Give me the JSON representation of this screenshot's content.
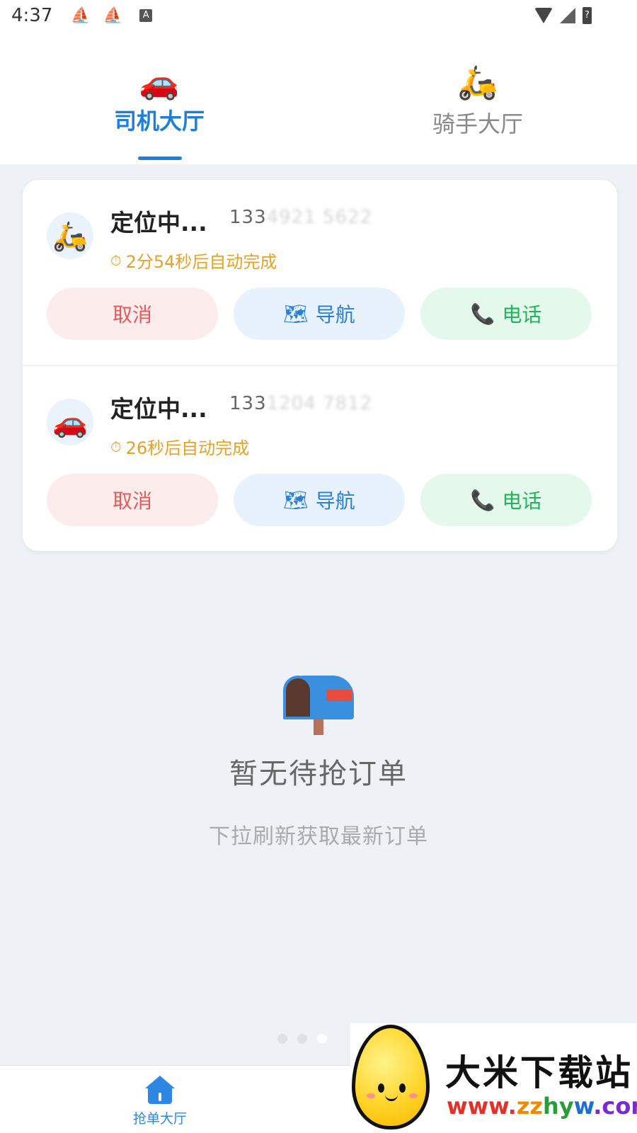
{
  "status_bar": {
    "time": "4:37",
    "icons": [
      "ship-icon",
      "ship-icon",
      "a-notification-icon",
      "wifi-icon",
      "signal-icon",
      "battery-icon"
    ],
    "battery_glyph": "?"
  },
  "top_tabs": [
    {
      "label": "司机大厅",
      "icon": "🚗",
      "active": true
    },
    {
      "label": "骑手大厅",
      "icon": "🛵",
      "active": false
    }
  ],
  "orders": [
    {
      "avatar_icon": "🛵",
      "title": "定位中...",
      "phone_prefix": "133",
      "phone_masked": "4921 5622",
      "timer": "2分54秒后自动完成",
      "buttons": {
        "cancel": "取消",
        "navigate": "导航",
        "call": "电话"
      }
    },
    {
      "avatar_icon": "🚗",
      "title": "定位中...",
      "phone_prefix": "133",
      "phone_masked": "1204 7812",
      "timer": "26秒后自动完成",
      "buttons": {
        "cancel": "取消",
        "navigate": "导航",
        "call": "电话"
      }
    }
  ],
  "icons": {
    "timer": "⏱",
    "navigate": "🗺",
    "call": "📞"
  },
  "empty_state": {
    "title": "暂无待抢订单",
    "subtitle": "下拉刷新获取最新订单"
  },
  "page_dots": {
    "count": 3,
    "active_index": 2
  },
  "bottom_nav": {
    "items": [
      {
        "label": "抢单大厅",
        "icon": "home-icon",
        "active": true
      }
    ]
  },
  "watermark": {
    "title": "大米下载站",
    "url_parts": [
      "www.",
      "zz",
      "hy",
      "w",
      ".com"
    ]
  },
  "colors": {
    "accent": "#1f7fd8",
    "timer": "#e8a223",
    "cancel": "#e25a5a",
    "navigate": "#2a7fd4",
    "call": "#22b35e",
    "background": "#eef1f6"
  }
}
